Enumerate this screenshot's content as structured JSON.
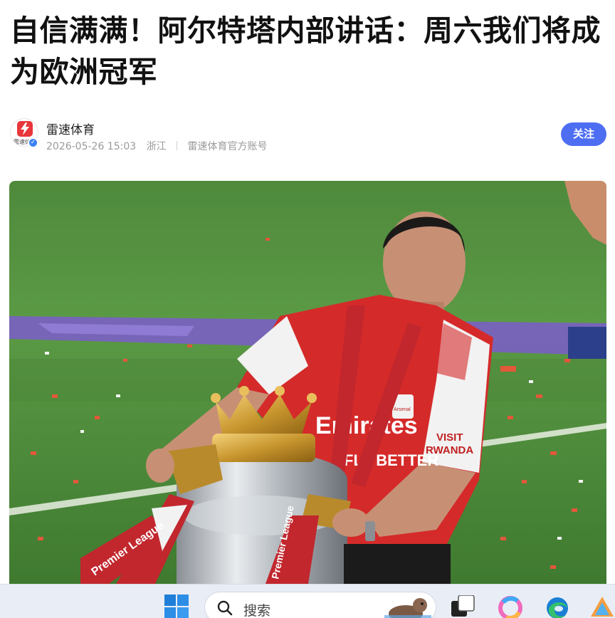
{
  "article": {
    "title": "自信满满！阿尔特塔内部讲话：周六我们将成为欧洲冠军"
  },
  "author": {
    "name": "雷速体育",
    "avatar_text": "雷速体育",
    "verified_icon": "verified-badge-icon",
    "date": "2026-05-26 15:03",
    "location": "浙江",
    "account_type": "雷速体育官方账号",
    "follow_label": "关注",
    "accent_color": "#4e6ef2"
  },
  "hero_image": {
    "description_icon": "trophy-photo",
    "shirt_text_sponsor_top": "Emirates",
    "shirt_text_sponsor_bottom": "FLY BETTER",
    "sleeve_text_top": "VISIT",
    "sleeve_text_bottom": "RWANDA",
    "ribbon_text": "Premier League",
    "badge_text": "Arsenal"
  },
  "taskbar": {
    "search_placeholder": "搜索",
    "icons": [
      "windows-start-icon",
      "search-icon",
      "task-view-icon",
      "copilot-icon",
      "edge-icon"
    ]
  }
}
